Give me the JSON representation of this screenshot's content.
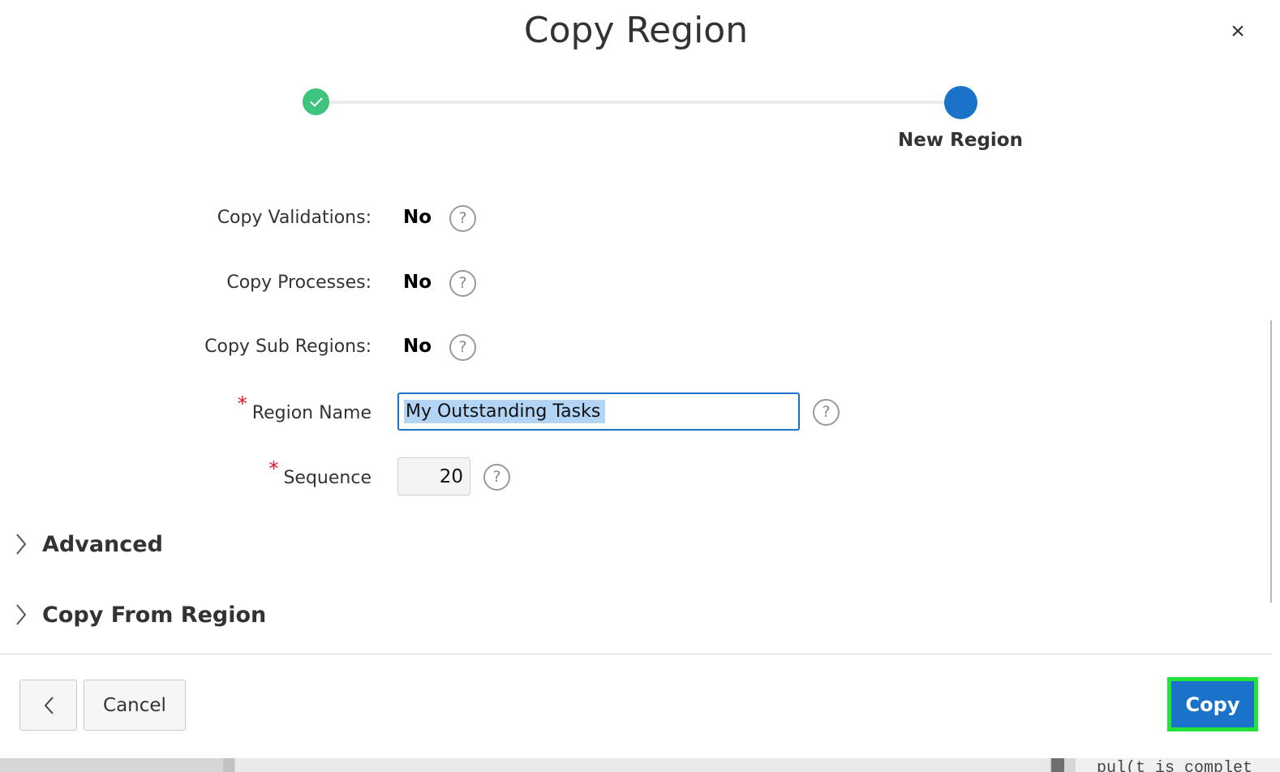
{
  "dialog": {
    "title": "Copy Region",
    "close_glyph": "×"
  },
  "wizard": {
    "steps": [
      {
        "status": "complete",
        "icon": "check-icon"
      },
      {
        "status": "current",
        "label": "New Region"
      }
    ]
  },
  "form": {
    "copy_validations": {
      "label": "Copy Validations:",
      "value": "No"
    },
    "copy_processes": {
      "label": "Copy Processes:",
      "value": "No"
    },
    "copy_sub_regions": {
      "label": "Copy Sub Regions:",
      "value": "No"
    },
    "region_name": {
      "label": "Region Name",
      "required_mark": "*",
      "value": "My Outstanding Tasks"
    },
    "sequence": {
      "label": "Sequence",
      "required_mark": "*",
      "value": "20"
    },
    "help_glyph": "?"
  },
  "sections": {
    "advanced": "Advanced",
    "copy_from_region": "Copy From Region"
  },
  "footer": {
    "cancel_label": "Cancel",
    "copy_label": "Copy"
  },
  "background": {
    "code_fragment": "pul(t is complet"
  },
  "colors": {
    "accent": "#1a72c9",
    "success": "#3ec47c",
    "required": "#e0121e",
    "highlight_border": "#22e33a"
  }
}
